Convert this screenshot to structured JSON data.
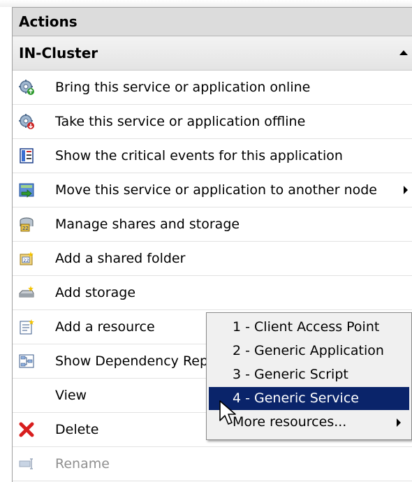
{
  "panel": {
    "title": "Actions",
    "section_title": "IN-Cluster"
  },
  "items": [
    {
      "label": "Bring this service or application online",
      "icon": "gear-online-icon"
    },
    {
      "label": "Take this service or application offline",
      "icon": "gear-offline-icon"
    },
    {
      "label": "Show the critical events for this application",
      "icon": "event-log-icon"
    },
    {
      "label": "Move this service or application to another node",
      "icon": "move-node-icon",
      "has_submenu": true
    },
    {
      "label": "Manage shares and storage",
      "icon": "shares-storage-icon"
    },
    {
      "label": "Add a shared folder",
      "icon": "shared-folder-icon"
    },
    {
      "label": "Add storage",
      "icon": "add-storage-icon"
    },
    {
      "label": "Add a resource",
      "icon": "add-resource-icon"
    },
    {
      "label": "Show Dependency Rep",
      "icon": "dependency-report-icon"
    },
    {
      "label": "View",
      "icon": ""
    },
    {
      "label": "Delete",
      "icon": "delete-x-icon"
    },
    {
      "label": "Rename",
      "icon": "rename-icon",
      "disabled": true
    }
  ],
  "context_menu": {
    "items": [
      {
        "label": "1 - Client Access Point"
      },
      {
        "label": "2 - Generic Application"
      },
      {
        "label": "3 - Generic Script"
      },
      {
        "label": "4 - Generic Service",
        "selected": true
      },
      {
        "label": "More resources...",
        "has_submenu": true
      }
    ]
  },
  "colors": {
    "selection": "#0a246a",
    "header_bg": "#dcdcdc",
    "delete_red": "#d81e1e"
  }
}
